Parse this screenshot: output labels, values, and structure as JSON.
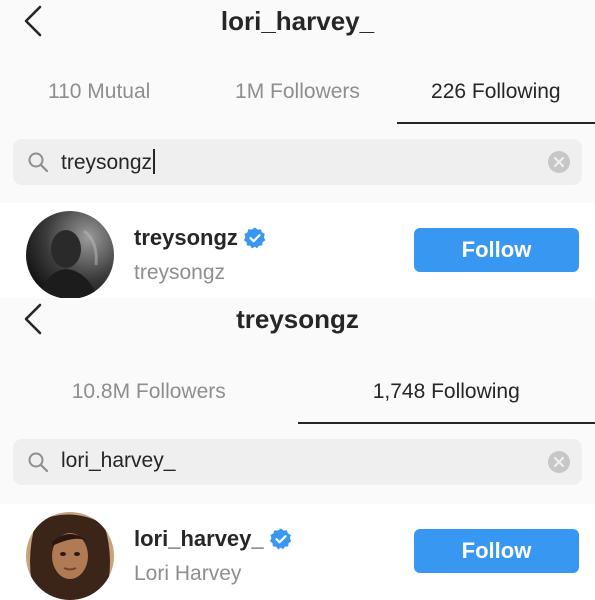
{
  "panels": [
    {
      "title": "lori_harvey_",
      "tabs": [
        {
          "label": "110 Mutual",
          "active": false
        },
        {
          "label": "1M Followers",
          "active": false
        },
        {
          "label": "226 Following",
          "active": true
        }
      ],
      "search": {
        "query": "treysongz",
        "cursor_visible": true
      },
      "result": {
        "username": "treysongz",
        "verified": true,
        "full_name": "treysongz",
        "button_label": "Follow",
        "avatar_style": "grayscale-photo"
      }
    },
    {
      "title": "treysongz",
      "tabs": [
        {
          "label": "10.8M Followers",
          "active": false
        },
        {
          "label": "1,748 Following",
          "active": true
        }
      ],
      "search": {
        "query": "lori_harvey_",
        "cursor_visible": false
      },
      "result": {
        "username": "lori_harvey_",
        "verified": true,
        "full_name": "Lori Harvey",
        "button_label": "Follow",
        "avatar_style": "color-photo"
      }
    }
  ],
  "icons": {
    "back": "chevron-left-icon",
    "search": "search-icon",
    "clear": "clear-icon",
    "verified": "verified-badge-icon"
  },
  "colors": {
    "follow_button": "#3897f0",
    "verified_badge": "#3897f0",
    "muted_text": "#8e8e8e",
    "search_bg": "#efefef"
  }
}
